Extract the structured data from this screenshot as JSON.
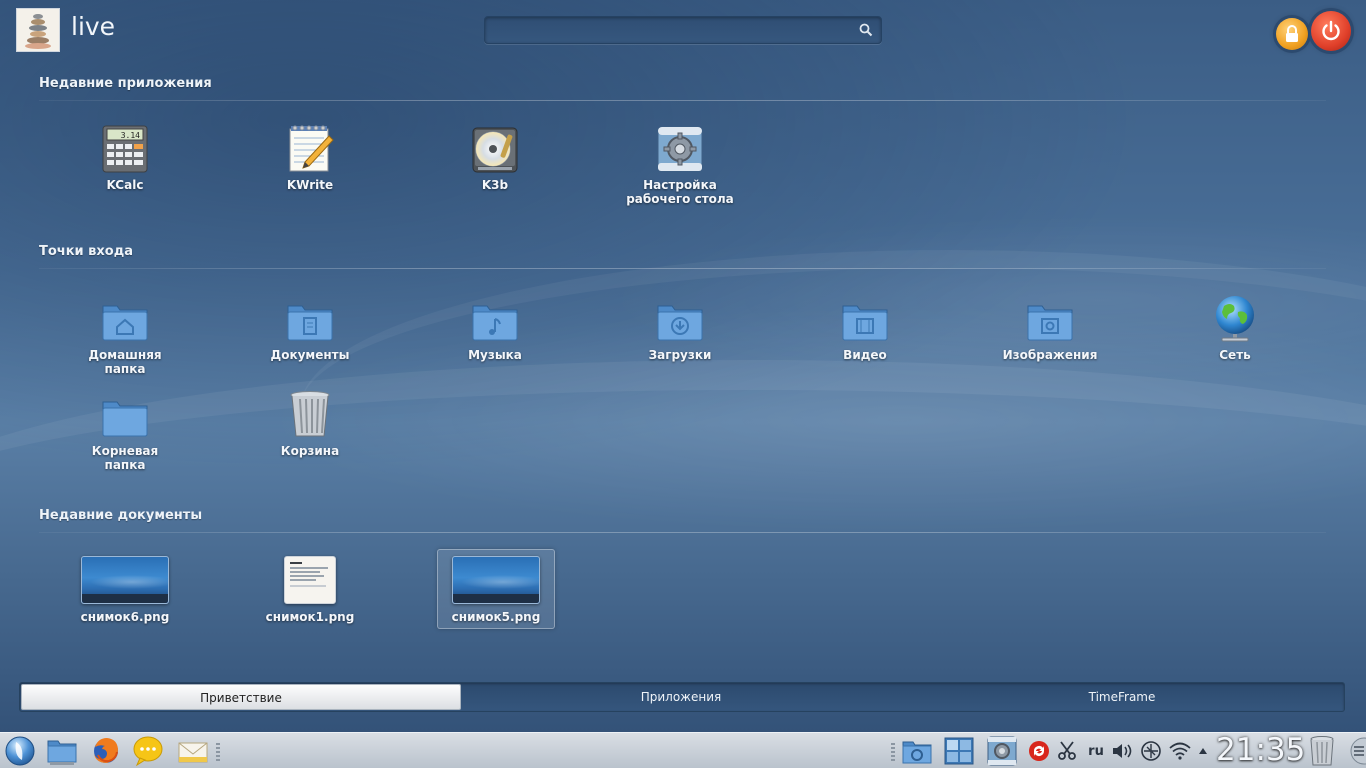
{
  "header": {
    "user_name": "live",
    "search_value": "",
    "search_placeholder": ""
  },
  "sections": {
    "recent_apps": {
      "title": "Недавние приложения",
      "items": [
        {
          "label": "KCalc",
          "icon": "calculator-icon"
        },
        {
          "label": "KWrite",
          "icon": "notepad-pencil-icon"
        },
        {
          "label": "K3b",
          "icon": "disc-burner-icon"
        },
        {
          "label": "Настройка\nрабочего стола",
          "icon": "system-settings-icon"
        }
      ]
    },
    "places": {
      "title": "Точки входа",
      "items": [
        {
          "label": "Домашняя\nпапка",
          "icon": "home-folder-icon"
        },
        {
          "label": "Документы",
          "icon": "documents-folder-icon"
        },
        {
          "label": "Музыка",
          "icon": "music-folder-icon"
        },
        {
          "label": "Загрузки",
          "icon": "downloads-folder-icon"
        },
        {
          "label": "Видео",
          "icon": "video-folder-icon"
        },
        {
          "label": "Изображения",
          "icon": "pictures-folder-icon"
        },
        {
          "label": "Сеть",
          "icon": "network-globe-icon"
        },
        {
          "label": "Корневая\nпапка",
          "icon": "root-folder-icon"
        },
        {
          "label": "Корзина",
          "icon": "trash-icon"
        }
      ]
    },
    "recent_docs": {
      "title": "Недавние документы",
      "items": [
        {
          "label": "снимок6.png",
          "thumb": "blue"
        },
        {
          "label": "снимок1.png",
          "thumb": "white"
        },
        {
          "label": "снимок5.png",
          "thumb": "blue",
          "selected": true
        }
      ]
    }
  },
  "tabs": [
    {
      "label": "Приветствие",
      "active": true
    },
    {
      "label": "Приложения",
      "active": false
    },
    {
      "label": "TimeFrame",
      "active": false
    }
  ],
  "taskbar": {
    "keyboard_layout": "ru",
    "clock": "21:35"
  },
  "colors": {
    "accent_lock": "#f0a020",
    "accent_power": "#e0402a",
    "folder_blue": "#5a9ad8"
  }
}
